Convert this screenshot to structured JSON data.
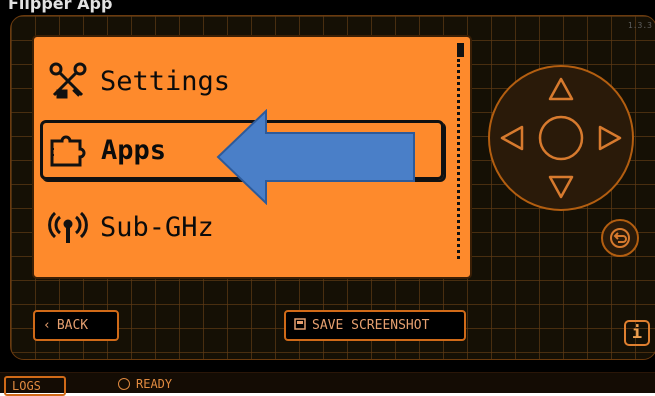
{
  "window": {
    "title": "Flipper App"
  },
  "version": "1.3.3",
  "menu": {
    "items": [
      {
        "label": "Settings",
        "icon": "settings-tools-icon",
        "selected": false
      },
      {
        "label": "Apps",
        "icon": "apps-puzzle-icon",
        "selected": true
      },
      {
        "label": "Sub-GHz",
        "icon": "antenna-icon",
        "selected": false
      }
    ]
  },
  "annotation": {
    "arrow": "blue-arrow-pointing-left",
    "color": "#4a7fc8"
  },
  "dpad": {
    "up": "up-arrow-icon",
    "down": "down-arrow-icon",
    "left": "left-arrow-icon",
    "right": "right-arrow-icon",
    "ok": "ok-circle-icon"
  },
  "buttons": {
    "back": "BACK",
    "save_screenshot": "SAVE SCREENSHOT",
    "info": "i",
    "logs": "LOGS"
  },
  "status": {
    "text": "READY"
  },
  "colors": {
    "screen": "#fe8a2c",
    "accent": "#d06a18",
    "background": "#000000"
  }
}
